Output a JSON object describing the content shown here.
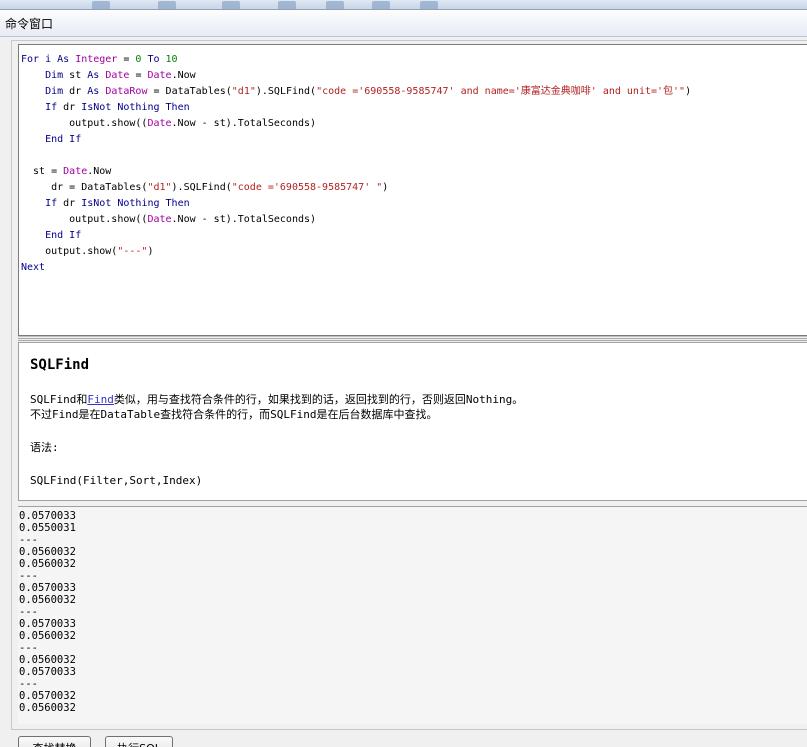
{
  "window": {
    "title": "命令窗口"
  },
  "editor": {
    "lines": [
      [
        [
          "k",
          "For i As "
        ],
        [
          "t",
          "Integer"
        ],
        [
          "p",
          " = "
        ],
        [
          "n",
          "0"
        ],
        [
          "k",
          " To "
        ],
        [
          "n",
          "10"
        ]
      ],
      [
        [
          "p",
          "    "
        ],
        [
          "k",
          "Dim"
        ],
        [
          "p",
          " st "
        ],
        [
          "k",
          "As"
        ],
        [
          "p",
          " "
        ],
        [
          "t",
          "Date"
        ],
        [
          "p",
          " = "
        ],
        [
          "t",
          "Date"
        ],
        [
          "p",
          ".Now"
        ]
      ],
      [
        [
          "p",
          "    "
        ],
        [
          "k",
          "Dim"
        ],
        [
          "p",
          " dr "
        ],
        [
          "k",
          "As"
        ],
        [
          "p",
          " "
        ],
        [
          "t",
          "DataRow"
        ],
        [
          "p",
          " = DataTables("
        ],
        [
          "s",
          "\"d1\""
        ],
        [
          "p",
          ").SQLFind("
        ],
        [
          "s",
          "\"code ='690558-9585747' and name='康富达金典咖啡' and unit='包'\""
        ],
        [
          "p",
          ")"
        ]
      ],
      [
        [
          "p",
          "    "
        ],
        [
          "k",
          "If"
        ],
        [
          "p",
          " dr "
        ],
        [
          "k",
          "IsNot Nothing Then"
        ]
      ],
      [
        [
          "p",
          "        output.show(("
        ],
        [
          "t",
          "Date"
        ],
        [
          "p",
          ".Now - st).TotalSeconds)"
        ]
      ],
      [
        [
          "p",
          "    "
        ],
        [
          "k",
          "End If"
        ]
      ],
      [
        [
          "p",
          ""
        ]
      ],
      [
        [
          "p",
          "  st = "
        ],
        [
          "t",
          "Date"
        ],
        [
          "p",
          ".Now"
        ]
      ],
      [
        [
          "p",
          "     dr = DataTables("
        ],
        [
          "s",
          "\"d1\""
        ],
        [
          "p",
          ").SQLFind("
        ],
        [
          "s",
          "\"code ='690558-9585747' \""
        ],
        [
          "p",
          ")"
        ]
      ],
      [
        [
          "p",
          "    "
        ],
        [
          "k",
          "If"
        ],
        [
          "p",
          " dr "
        ],
        [
          "k",
          "IsNot Nothing Then"
        ]
      ],
      [
        [
          "p",
          "        output.show(("
        ],
        [
          "t",
          "Date"
        ],
        [
          "p",
          ".Now - st).TotalSeconds)"
        ]
      ],
      [
        [
          "p",
          "    "
        ],
        [
          "k",
          "End If"
        ]
      ],
      [
        [
          "p",
          "    output.show("
        ],
        [
          "s",
          "\"---\""
        ],
        [
          "p",
          ")"
        ]
      ],
      [
        [
          "k",
          "Next"
        ]
      ]
    ]
  },
  "help": {
    "title": "SQLFind",
    "line1_a": "SQLFind和",
    "line1_link": "Find",
    "line1_b": "类似，用与查找符合条件的行，如果找到的话，返回找到的行，否则返回Nothing。",
    "line2": "不过Find是在DataTable查找符合条件的行，而SQLFind是在后台数据库中查找。",
    "syntax_label": "语法:",
    "syntax": "SQLFind(Filter,Sort,Index)"
  },
  "output": {
    "lines": [
      "0.0570033",
      "0.0550031",
      "---",
      "0.0560032",
      "0.0560032",
      "---",
      "0.0570033",
      "0.0560032",
      "---",
      "0.0570033",
      "0.0560032",
      "---",
      "0.0560032",
      "0.0570033",
      "---",
      "0.0570032",
      "0.0560032"
    ]
  },
  "buttons": {
    "find_replace": "查找替换",
    "exec_sql": "执行SQL"
  }
}
